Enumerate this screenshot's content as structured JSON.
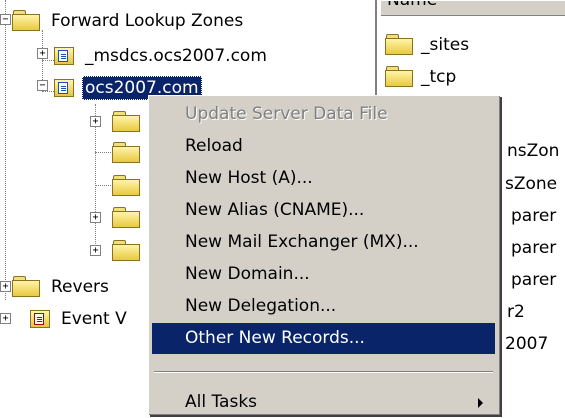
{
  "tree": {
    "forward_zones": "Forward Lookup Zones",
    "msdcs_zone": "_msdcs.ocs2007.com",
    "selected_zone": "ocs2007.com",
    "reverse_partial": "Revers",
    "event_partial": "Event V"
  },
  "list": {
    "column_name": "Name",
    "items": [
      "_sites",
      "_tcp"
    ],
    "fragments": [
      "nsZon",
      "sZone",
      "parer",
      "parer",
      "parer",
      "r2",
      "2007"
    ]
  },
  "menu": {
    "items": [
      {
        "label": "Update Server Data File",
        "disabled": true
      },
      {
        "label": "Reload"
      },
      {
        "label": "New Host (A)..."
      },
      {
        "label": "New Alias (CNAME)..."
      },
      {
        "label": "New Mail Exchanger (MX)..."
      },
      {
        "label": "New Domain..."
      },
      {
        "label": "New Delegation..."
      },
      {
        "label": "Other New Records...",
        "highlighted": true
      }
    ],
    "all_tasks": "All Tasks"
  },
  "colors": {
    "selection": "#0a246a",
    "menu_face": "#d4d0c8"
  }
}
